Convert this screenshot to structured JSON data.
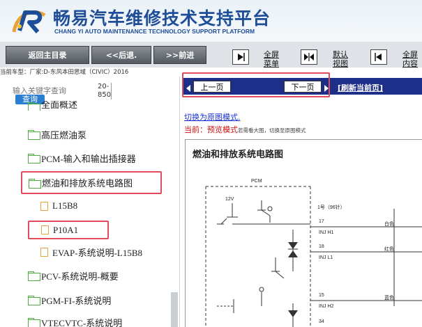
{
  "header": {
    "title": "畅易汽车维修技术支持平台",
    "subtitle": "CHANG YI AUTO MAINTENANCE TECHNOLOGY SUPPORT PLATFORM"
  },
  "toolbar": {
    "main_menu_label": "返回主目录",
    "back_label": "<<后退.",
    "forward_label": ">>前进",
    "fullscreen_menu_label_line1": "全屏",
    "fullscreen_menu_label_line2": "菜单",
    "default_view_label_line1": "默认",
    "default_view_label_line2": "视图",
    "fullscreen_content_label_line1": "全屏",
    "fullscreen_content_label_line2": "内容"
  },
  "vehicle_info": "当前车型：厂家:D-东风本田思域（CIVIC）2016",
  "sidebar": {
    "search_placeholder": "输入关键字查询",
    "range_top": "20-",
    "range_bottom": "850",
    "search_button": "查询",
    "items": [
      {
        "label": "全面概述",
        "type": "folder"
      },
      {
        "label": "高压燃油泵",
        "type": "folder"
      },
      {
        "label": "PCM-输入和输出插接器",
        "type": "folder"
      },
      {
        "label": "燃油和排放系统电路图",
        "type": "folder-open"
      },
      {
        "label": "L15B8",
        "type": "file"
      },
      {
        "label": "P10A1",
        "type": "file"
      },
      {
        "label": "EVAP-系统说明-L15B8",
        "type": "file"
      },
      {
        "label": "PCV-系统说明-概要",
        "type": "folder"
      },
      {
        "label": "PGM-FI-系统说明",
        "type": "folder"
      },
      {
        "label": "VTECVTC-系统说明",
        "type": "folder"
      }
    ]
  },
  "content": {
    "prev_label": "上一页",
    "next_label": "下一页",
    "refresh_label": "[刷新当前页]",
    "switch_link": "切换为原图模式.",
    "mode_label": "当前：",
    "mode_value": "预览模式",
    "mode_hint": "若需看大图，切换至原图模式",
    "diagram_title": "燃油和排放系统电路图",
    "diagram": {
      "module": "PCM",
      "voltage": "12V",
      "cyl1": "1号（96针）",
      "pin1": "17",
      "sig1": "INJ H1",
      "wire1": "白色",
      "pin2": "18",
      "sig2": "INJ L1",
      "wire2": "红色",
      "pin3": "15",
      "sig3": "INJ H2",
      "wire3": "蓝色",
      "pin4": "34"
    }
  },
  "colors": {
    "brand_blue": "#1f4e98",
    "nav_bar": "#1e2f8a",
    "highlight": "#e04a5a",
    "folder_green": "#4cae3c",
    "file_orange": "#e8a33a"
  }
}
